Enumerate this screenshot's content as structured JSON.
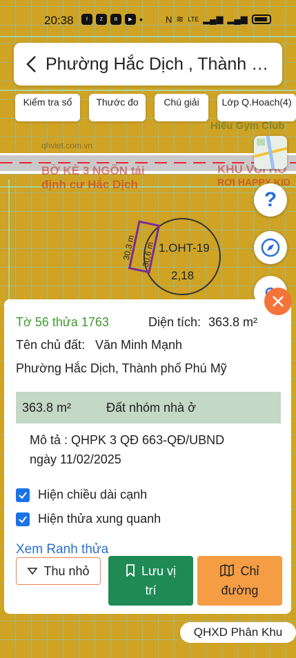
{
  "status": {
    "time": "20:38"
  },
  "search": {
    "title": "Phường Hắc Dịch , Thành phố Phú Mỹ"
  },
  "chips": [
    {
      "label": "Kiểm tra sổ"
    },
    {
      "label": "Thước đo"
    },
    {
      "label": "Chú giải"
    },
    {
      "label": "Lớp Q.Hoach(4)"
    }
  ],
  "map": {
    "labels": [
      {
        "text": "qhviet.com.vn"
      },
      {
        "text": "BỜ KÈ 3 NGÕN tái"
      },
      {
        "text": "định cư Hắc Dịch"
      },
      {
        "text": "KHU VUI HO"
      },
      {
        "text": "RƠI HAPPY KID"
      },
      {
        "text": "Hiếu Gym Club"
      }
    ],
    "edge1": "30,3 m",
    "edge2": "30,6 m",
    "zone_code": "1.OHT-19",
    "zone_value": "2,18"
  },
  "sheet": {
    "parcel": "Tờ 56 thửa 1763",
    "area_label": "Diện tích:",
    "area_value": "363.8 m²",
    "owner_label": "Tên chủ đất:",
    "owner": "Văn Minh Mạnh",
    "address": "Phường Hắc Dịch, Thành phố Phú Mỹ",
    "info_area": "363.8 m²",
    "info_type": "Đất nhóm nhà ở",
    "desc_line1": "Mô tả : QHPK 3 QĐ 663-QĐ/UBND",
    "desc_line2": "ngày 11/02/2025",
    "check1": "Hiện chiều dài cạnh",
    "check2": "Hiện thửa xung quanh",
    "link": "Xem Ranh thửa",
    "btn_collapse": "Thu nhỏ",
    "btn_save": "Lưu vị trí",
    "btn_route": "Chỉ đường"
  },
  "bottom_tag": "QHXD Phân Khu",
  "colors": {
    "accent": "#f4743b",
    "green": "#1f8a55",
    "orange": "#f49d45",
    "link": "#2a6fd6"
  }
}
